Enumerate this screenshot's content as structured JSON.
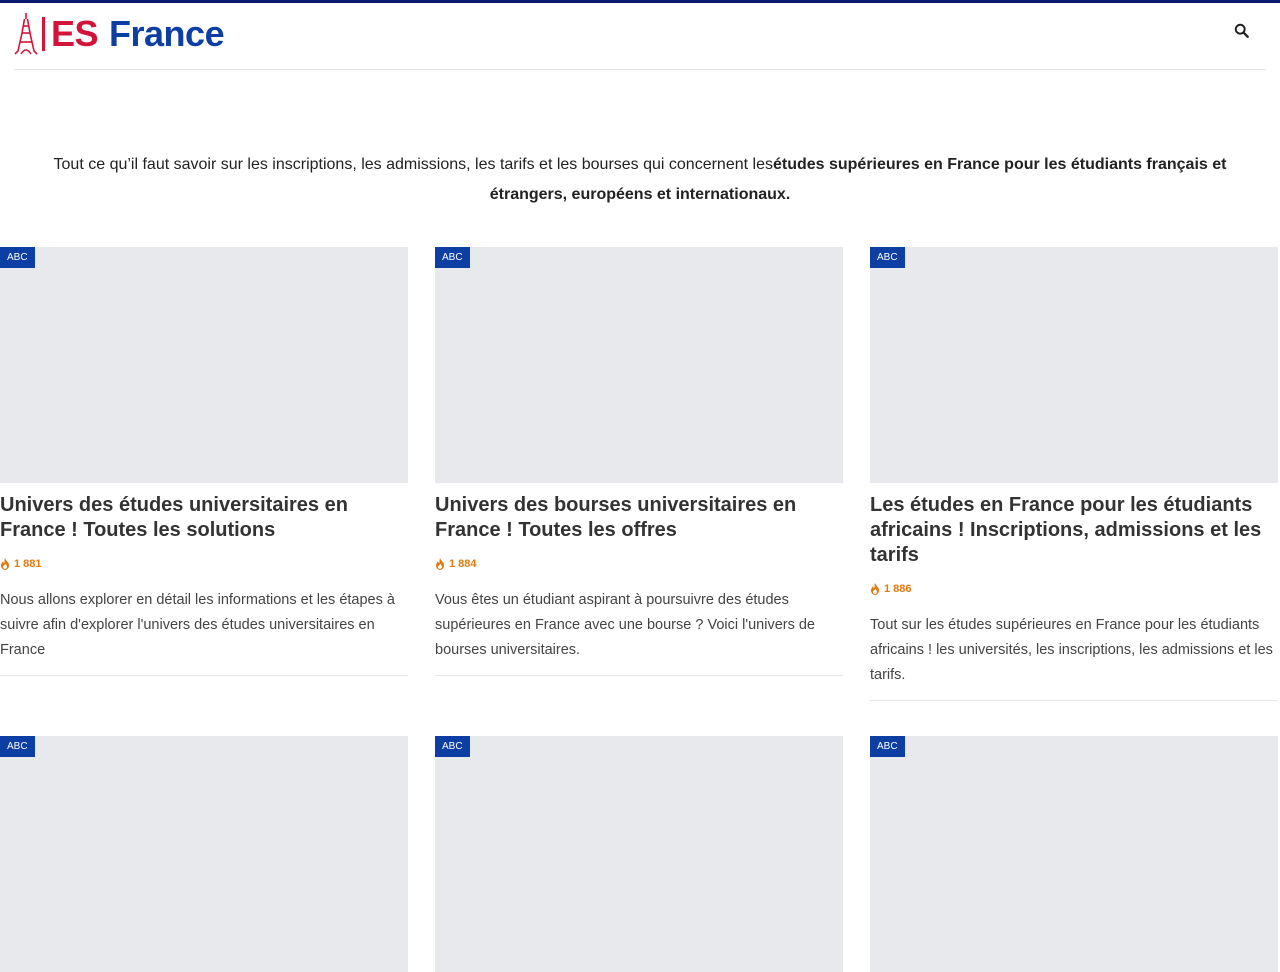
{
  "brand": {
    "es": "ES",
    "france": "France",
    "colors": {
      "red": "#d3143a",
      "blue": "#0d3ea3"
    }
  },
  "header": {
    "search_icon": "search-icon"
  },
  "intro": {
    "plain": "Tout ce qu’il faut savoir sur les inscriptions, les admissions, les tarifs et les bourses qui concernent les",
    "bold": "études supérieures en France pour les étudiants français et étrangers, européens et internationaux."
  },
  "cards": [
    {
      "badge": "ABC",
      "title": "Univers des études universitaires en France ! Toutes les solutions",
      "views": "1 881",
      "excerpt": "Nous allons explorer en détail les informations et les étapes à suivre afin d'explorer l'univers des études universitaires en France"
    },
    {
      "badge": "ABC",
      "title": "Univers des bourses universitaires en France ! Toutes les offres",
      "views": "1 884",
      "excerpt": "Vous êtes un étudiant aspirant à poursuivre des études supérieures en France avec une bourse ? Voici l'univers de bourses universitaires."
    },
    {
      "badge": "ABC",
      "title": "Les études en France pour les étudiants africains ! Inscriptions, admissions et les tarifs",
      "views": "1 886",
      "excerpt": "Tout sur les études supérieures en France pour les étudiants africains ! les universités, les inscriptions, les admissions et les tarifs."
    },
    {
      "badge": "ABC"
    },
    {
      "badge": "ABC"
    },
    {
      "badge": "ABC"
    }
  ]
}
